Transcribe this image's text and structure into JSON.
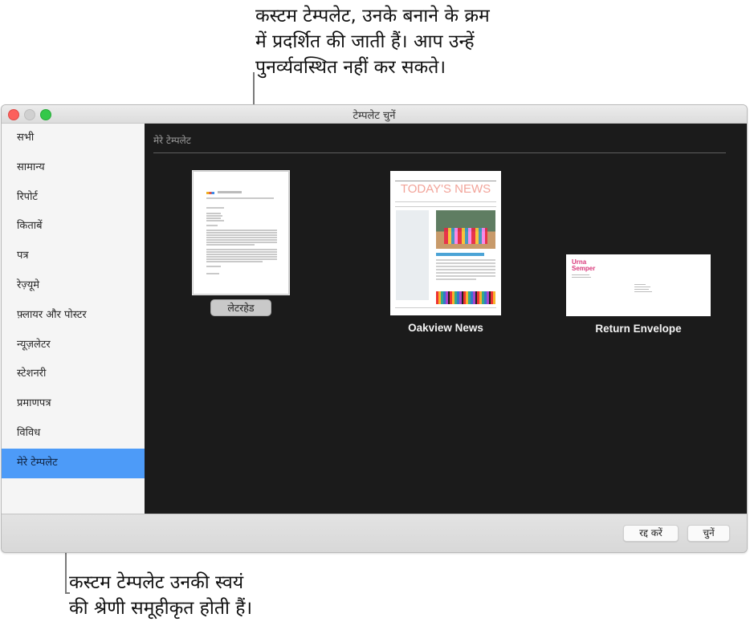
{
  "callouts": {
    "top": [
      "कस्टम टेम्पलेट, उनके बनाने के क्रम",
      "में प्रदर्शित की जाती हैं। आप उन्हें",
      "पुनर्व्यवस्थित नहीं कर सकते।"
    ],
    "bottom": [
      "कस्टम टेम्पलेट उनकी स्वयं",
      "की श्रेणी समूहीकृत होती हैं।"
    ]
  },
  "window": {
    "title": "टेम्पलेट चुनें"
  },
  "sidebar": {
    "items": [
      {
        "label": "सभी"
      },
      {
        "label": "सामान्य"
      },
      {
        "label": "रिपोर्ट"
      },
      {
        "label": "किताबें"
      },
      {
        "label": "पत्र"
      },
      {
        "label": "रेज़्यूमे"
      },
      {
        "label": "फ़्लायर और पोस्टर"
      },
      {
        "label": "न्यूज़लेटर"
      },
      {
        "label": "स्टेशनरी"
      },
      {
        "label": "प्रमाणपत्र"
      },
      {
        "label": "विविध"
      },
      {
        "label": "मेरे टेम्पलेट",
        "selected": true
      }
    ]
  },
  "main": {
    "section_title": "मेरे टेम्पलेट",
    "templates": [
      {
        "name": "लेटरहेड",
        "selected": true,
        "thumb": {
          "sender": "Urna Semper"
        }
      },
      {
        "name": "Oakview News",
        "thumb": {
          "headline": "TODAY'S NEWS",
          "subhead": "Integer facilisis arcu"
        }
      },
      {
        "name": "Return Envelope",
        "thumb": {
          "sender_line1": "Urna",
          "sender_line2": "Semper"
        }
      }
    ],
    "colors": {
      "accent_selected": "#4d9bf8",
      "envelope_name": "#d9387a",
      "news_title": "#f2a49a"
    }
  },
  "footer": {
    "cancel_label": "रद्द करें",
    "choose_label": "चुनें"
  }
}
